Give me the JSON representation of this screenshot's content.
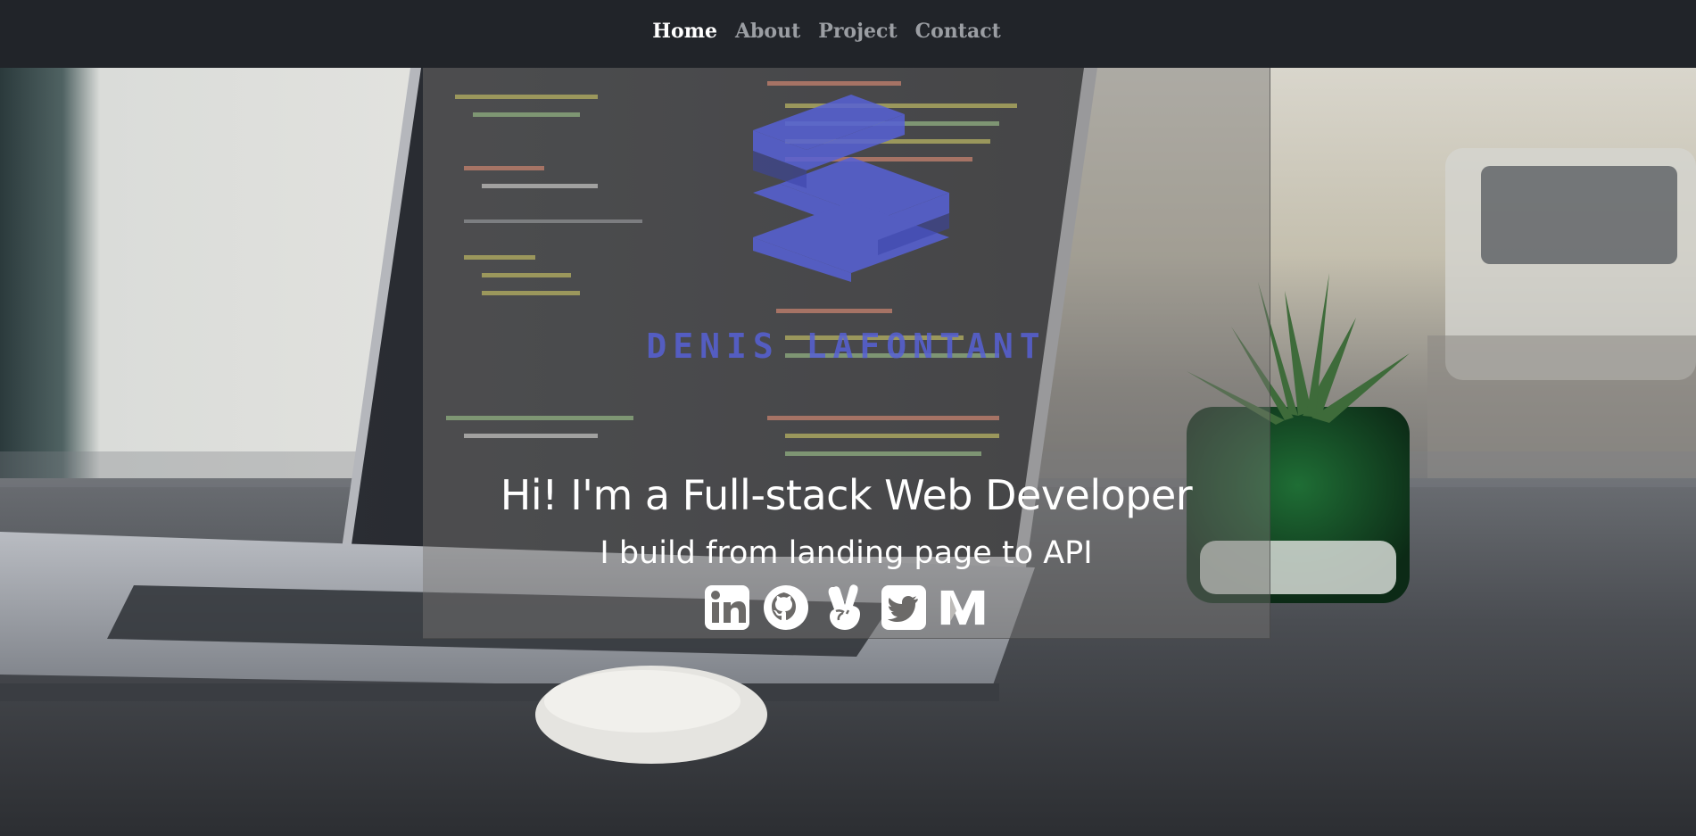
{
  "nav": {
    "items": [
      {
        "label": "Home",
        "active": true
      },
      {
        "label": "About",
        "active": false
      },
      {
        "label": "Project",
        "active": false
      },
      {
        "label": "Contact",
        "active": false
      }
    ]
  },
  "hero": {
    "brand_name": "DENIS LAFONTANT",
    "headline": "Hi! I'm a Full-stack Web Developer",
    "subheadline": "I build from landing page to API",
    "logo_icon": "stacked-layers-logo",
    "logo_color": "#5761d6"
  },
  "socials": [
    {
      "name": "linkedin-icon",
      "label": "LinkedIn"
    },
    {
      "name": "github-icon",
      "label": "GitHub"
    },
    {
      "name": "angellist-icon",
      "label": "AngelList"
    },
    {
      "name": "twitter-icon",
      "label": "Twitter"
    },
    {
      "name": "medium-icon",
      "label": "Medium"
    }
  ],
  "colors": {
    "navbar_bg": "#212429",
    "nav_active": "#ffffff",
    "nav_inactive": "#9b9ea3",
    "brand": "#5761d6"
  }
}
